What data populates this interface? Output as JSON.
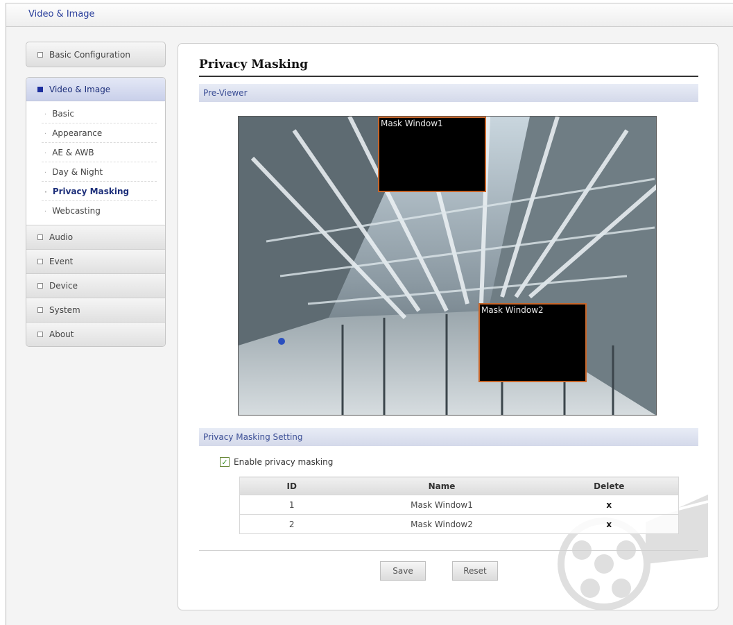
{
  "breadcrumb": "Video & Image",
  "sidebar": {
    "top_item": "Basic Configuration",
    "group_title": "Video & Image",
    "subitems": [
      "Basic",
      "Appearance",
      "AE & AWB",
      "Day & Night",
      "Privacy Masking",
      "Webcasting"
    ],
    "active_subitem": "Privacy Masking",
    "items": [
      "Audio",
      "Event",
      "Device",
      "System",
      "About"
    ]
  },
  "main": {
    "title": "Privacy Masking",
    "preview_section": "Pre-Viewer",
    "masks_overlay": [
      "Mask Window1",
      "Mask Window2"
    ],
    "setting_section": "Privacy Masking Setting",
    "enable_label": "Enable privacy masking",
    "enable_checked": true,
    "table": {
      "headers": [
        "ID",
        "Name",
        "Delete"
      ],
      "rows": [
        {
          "id": "1",
          "name": "Mask Window1",
          "delete": "x"
        },
        {
          "id": "2",
          "name": "Mask Window2",
          "delete": "x"
        }
      ]
    },
    "save_label": "Save",
    "reset_label": "Reset"
  },
  "colors": {
    "accent": "#1d2f9e",
    "mask_border": "#c8662a",
    "section_text": "#3c4f96"
  },
  "icons": {
    "checkbox": "checkmark-icon",
    "delete": "delete-x-icon",
    "nav_bullet": "square-bullet-icon"
  }
}
